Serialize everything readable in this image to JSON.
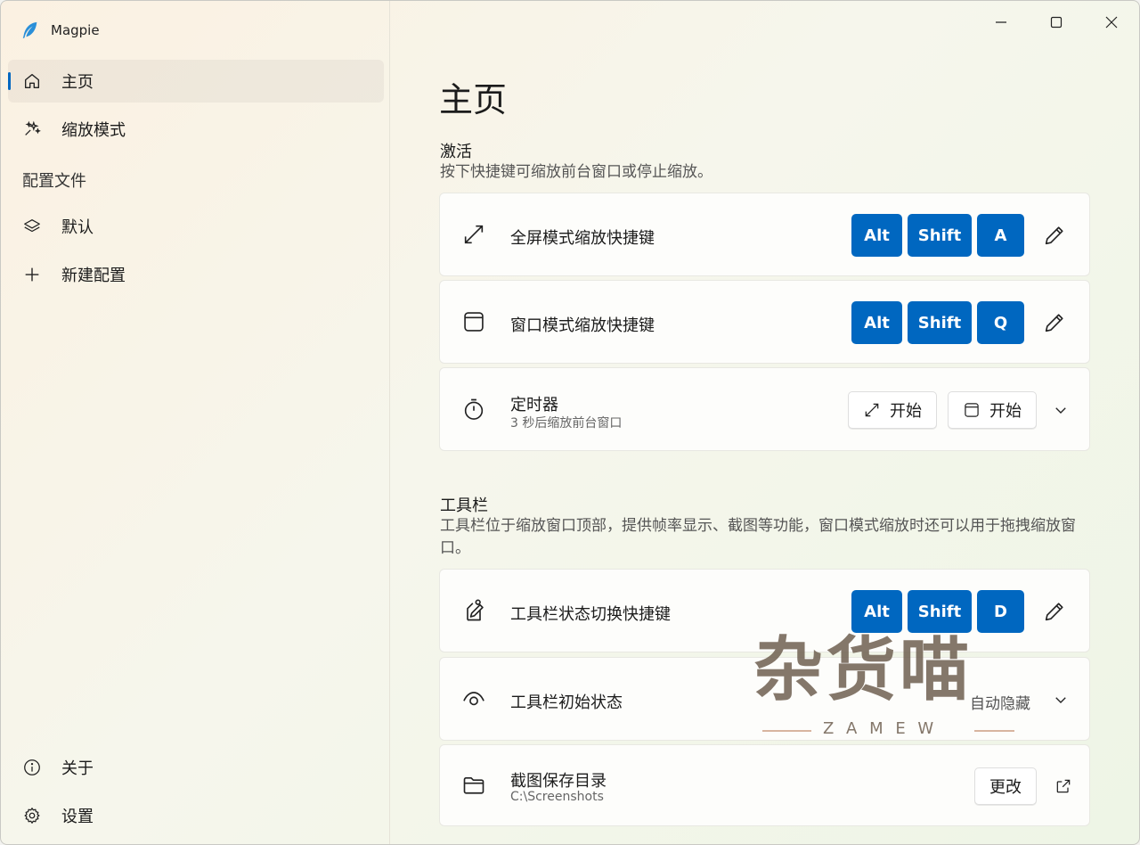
{
  "app": {
    "title": "Magpie"
  },
  "sidebar": {
    "items": [
      {
        "label": "主页",
        "icon": "home-icon"
      },
      {
        "label": "缩放模式",
        "icon": "sparkle-icon"
      }
    ],
    "profiles_header": "配置文件",
    "profiles": [
      {
        "label": "默认",
        "icon": "layers-icon"
      },
      {
        "label": "新建配置",
        "icon": "plus-icon"
      }
    ],
    "footer": [
      {
        "label": "关于",
        "icon": "info-icon"
      },
      {
        "label": "设置",
        "icon": "gear-icon"
      }
    ]
  },
  "main": {
    "title": "主页",
    "activation": {
      "title": "激活",
      "desc": "按下快捷键可缩放前台窗口或停止缩放。",
      "fullscreen": {
        "label": "全屏模式缩放快捷键",
        "keys": [
          "Alt",
          "Shift",
          "A"
        ]
      },
      "windowed": {
        "label": "窗口模式缩放快捷键",
        "keys": [
          "Alt",
          "Shift",
          "Q"
        ]
      },
      "timer": {
        "label": "定时器",
        "sublabel": "3 秒后缩放前台窗口",
        "btn_fullscreen": "开始",
        "btn_windowed": "开始"
      }
    },
    "toolbar": {
      "title": "工具栏",
      "desc": "工具栏位于缩放窗口顶部，提供帧率显示、截图等功能，窗口模式缩放时还可以用于拖拽缩放窗口。",
      "toggle": {
        "label": "工具栏状态切换快捷键",
        "keys": [
          "Alt",
          "Shift",
          "D"
        ]
      },
      "initial": {
        "label": "工具栏初始状态",
        "value": "自动隐藏"
      },
      "screenshot": {
        "label": "截图保存目录",
        "sublabel": "C:\\Screenshots",
        "change": "更改"
      }
    }
  },
  "watermark": {
    "text": "杂货喵",
    "sub": "Z A M E W"
  },
  "colors": {
    "accent": "#0067c0"
  }
}
